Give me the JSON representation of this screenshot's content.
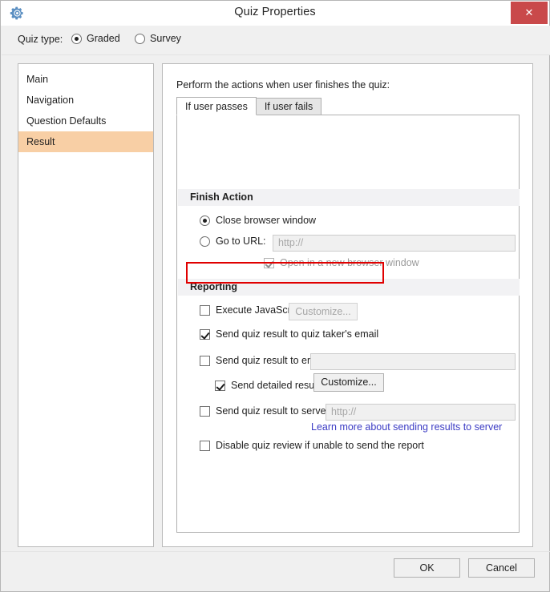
{
  "window": {
    "title": "Quiz Properties",
    "gear_icon": "gear-icon",
    "close_label": "✕"
  },
  "quiz_type": {
    "label": "Quiz type:",
    "options": [
      {
        "label": "Graded",
        "selected": true
      },
      {
        "label": "Survey",
        "selected": false
      }
    ]
  },
  "sidebar": {
    "items": [
      {
        "label": "Main",
        "selected": false
      },
      {
        "label": "Navigation",
        "selected": false
      },
      {
        "label": "Question Defaults",
        "selected": false
      },
      {
        "label": "Result",
        "selected": true
      }
    ],
    "selected_color": "#f8cfa5"
  },
  "main": {
    "intro": "Perform the actions when user finishes the quiz:",
    "tabs": [
      {
        "label": "If user passes",
        "active": true
      },
      {
        "label": "If user fails",
        "active": false
      }
    ],
    "finish_action": {
      "title": "Finish Action",
      "close_browser": {
        "label": "Close browser window",
        "selected": true
      },
      "go_to_url": {
        "label": "Go to URL:",
        "selected": false,
        "placeholder": "http://"
      },
      "open_new_window": {
        "label": "Open in a new browser window",
        "checked": true,
        "disabled": true
      }
    },
    "reporting": {
      "title": "Reporting",
      "execute_javascript": {
        "label": "Execute JavaScript",
        "checked": false
      },
      "execute_javascript_button": {
        "label": "Customize...",
        "disabled": true
      },
      "send_to_quiz_taker": {
        "label": "Send quiz result to quiz taker's email",
        "checked": true,
        "highlighted": true
      },
      "send_to_email": {
        "label": "Send quiz result to email",
        "checked": false,
        "value": ""
      },
      "send_detailed": {
        "label": "Send detailed results",
        "checked": true
      },
      "send_detailed_button": {
        "label": "Customize...",
        "disabled": false
      },
      "send_to_server": {
        "label": "Send quiz result to server",
        "checked": false,
        "placeholder": "http://"
      },
      "learn_more_link": "Learn more about sending results to server",
      "disable_review": {
        "label": "Disable quiz review if unable to send the report",
        "checked": false
      }
    }
  },
  "footer": {
    "ok_label": "OK",
    "cancel_label": "Cancel"
  },
  "colors": {
    "accent_red": "#c9494a",
    "highlight_red": "#e00000",
    "link_blue": "#3b3bc4",
    "selection_peach": "#f8cfa5"
  }
}
